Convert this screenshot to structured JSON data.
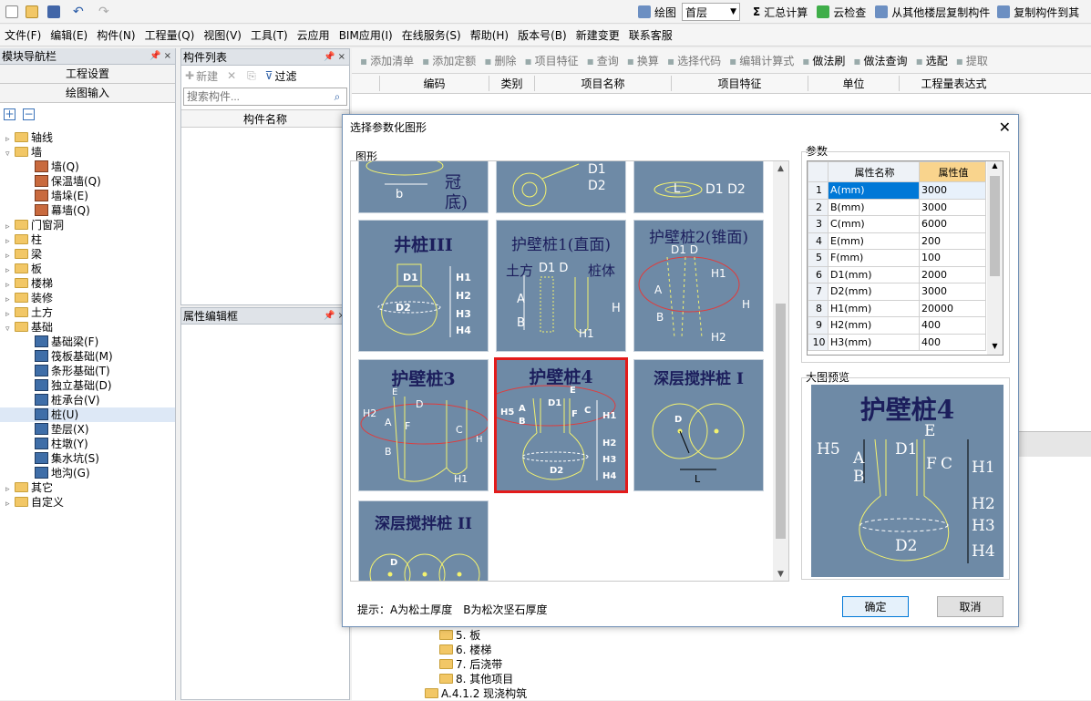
{
  "toolbar_top": {
    "draw_label": "绘图",
    "floor_value": "首层",
    "sum_label": "汇总计算",
    "cloud_check_label": "云检查",
    "copy_from_floor_label": "从其他楼层复制构件",
    "copy_to_label": "复制构件到其"
  },
  "menu": [
    "文件(F)",
    "编辑(E)",
    "构件(N)",
    "工程量(Q)",
    "视图(V)",
    "工具(T)",
    "云应用",
    "BIM应用(I)",
    "在线服务(S)",
    "帮助(H)",
    "版本号(B)",
    "新建变更",
    "联系客服"
  ],
  "nav": {
    "title": "模块导航栏",
    "btn_project_settings": "工程设置",
    "btn_drawing_input": "绘图输入",
    "tree": [
      {
        "t": "轴线",
        "lvl": 0,
        "exp": "plus",
        "kind": "folder"
      },
      {
        "t": "墙",
        "lvl": 0,
        "exp": "minus",
        "kind": "folder"
      },
      {
        "t": "墙(Q)",
        "lvl": 1,
        "kind": "leaf"
      },
      {
        "t": "保温墙(Q)",
        "lvl": 1,
        "kind": "leaf"
      },
      {
        "t": "墙垛(E)",
        "lvl": 1,
        "kind": "leaf"
      },
      {
        "t": "幕墙(Q)",
        "lvl": 1,
        "kind": "leaf"
      },
      {
        "t": "门窗洞",
        "lvl": 0,
        "exp": "plus",
        "kind": "folder"
      },
      {
        "t": "柱",
        "lvl": 0,
        "exp": "plus",
        "kind": "folder"
      },
      {
        "t": "梁",
        "lvl": 0,
        "exp": "plus",
        "kind": "folder"
      },
      {
        "t": "板",
        "lvl": 0,
        "exp": "plus",
        "kind": "folder"
      },
      {
        "t": "楼梯",
        "lvl": 0,
        "exp": "plus",
        "kind": "folder"
      },
      {
        "t": "装修",
        "lvl": 0,
        "exp": "plus",
        "kind": "folder"
      },
      {
        "t": "土方",
        "lvl": 0,
        "exp": "plus",
        "kind": "folder"
      },
      {
        "t": "基础",
        "lvl": 0,
        "exp": "minus",
        "kind": "folder"
      },
      {
        "t": "基础梁(F)",
        "lvl": 1,
        "kind": "blue"
      },
      {
        "t": "筏板基础(M)",
        "lvl": 1,
        "kind": "blue"
      },
      {
        "t": "条形基础(T)",
        "lvl": 1,
        "kind": "blue"
      },
      {
        "t": "独立基础(D)",
        "lvl": 1,
        "kind": "blue"
      },
      {
        "t": "桩承台(V)",
        "lvl": 1,
        "kind": "blue"
      },
      {
        "t": "桩(U)",
        "lvl": 1,
        "kind": "blue",
        "selected": true
      },
      {
        "t": "垫层(X)",
        "lvl": 1,
        "kind": "blue"
      },
      {
        "t": "柱墩(Y)",
        "lvl": 1,
        "kind": "blue"
      },
      {
        "t": "集水坑(S)",
        "lvl": 1,
        "kind": "blue"
      },
      {
        "t": "地沟(G)",
        "lvl": 1,
        "kind": "blue"
      },
      {
        "t": "其它",
        "lvl": 0,
        "exp": "plus",
        "kind": "folder"
      },
      {
        "t": "自定义",
        "lvl": 0,
        "exp": "plus",
        "kind": "folder"
      }
    ]
  },
  "comp_list": {
    "title": "构件列表",
    "new_label": "新建",
    "filter_label": "过滤",
    "search_placeholder": "搜索构件...",
    "col_name": "构件名称"
  },
  "prop_editor": {
    "title": "属性编辑框"
  },
  "main_toolbar": [
    "添加清单",
    "添加定额",
    "删除",
    "项目特征",
    "查询",
    "换算",
    "选择代码",
    "编辑计算式",
    "做法刷",
    "做法查询",
    "选配",
    "提取"
  ],
  "grid_cols": [
    "编码",
    "类别",
    "项目名称",
    "项目特征",
    "单位",
    "工程量表达式"
  ],
  "bottom_tree": [
    "5. 板",
    "6. 楼梯",
    "7. 后浇带",
    "8. 其他项目",
    "A.4.1.2 现浇构筑"
  ],
  "dialog": {
    "title": "选择参数化图形",
    "shapes_label": "图形",
    "params_label": "参数",
    "preview_label": "大图预览",
    "hint": "提示：A为松土厚度　B为松次坚石厚度",
    "ok": "确定",
    "cancel": "取消",
    "cells": [
      {
        "name": "井桩III"
      },
      {
        "name": "护壁桩1(直面)"
      },
      {
        "name": "护壁桩2(锥面)"
      },
      {
        "name": "护壁桩3"
      },
      {
        "name": "护壁桩4",
        "selected": true
      },
      {
        "name": "深层搅拌桩 I"
      },
      {
        "name": "深层搅拌桩 II"
      }
    ],
    "top_cell_text": {
      "c1_a": "冠",
      "c1_b": "底)",
      "c1_c": "b",
      "c2_a": "D1",
      "c2_b": "D2",
      "c3_a": "L",
      "c3_b": "D1 D2"
    },
    "param_headers": {
      "name": "属性名称",
      "value": "属性值"
    },
    "params": [
      {
        "n": "1",
        "name": "A(mm)",
        "value": "3000"
      },
      {
        "n": "2",
        "name": "B(mm)",
        "value": "3000"
      },
      {
        "n": "3",
        "name": "C(mm)",
        "value": "6000"
      },
      {
        "n": "4",
        "name": "E(mm)",
        "value": "200"
      },
      {
        "n": "5",
        "name": "F(mm)",
        "value": "100"
      },
      {
        "n": "6",
        "name": "D1(mm)",
        "value": "2000"
      },
      {
        "n": "7",
        "name": "D2(mm)",
        "value": "3000"
      },
      {
        "n": "8",
        "name": "H1(mm)",
        "value": "20000"
      },
      {
        "n": "9",
        "name": "H2(mm)",
        "value": "400"
      },
      {
        "n": "10",
        "name": "H3(mm)",
        "value": "400"
      }
    ],
    "preview_title": "护壁桩4"
  },
  "colors": {
    "cell_bg": "#6e8aa6",
    "selection": "#e31b1b",
    "accent": "#0078d7"
  }
}
